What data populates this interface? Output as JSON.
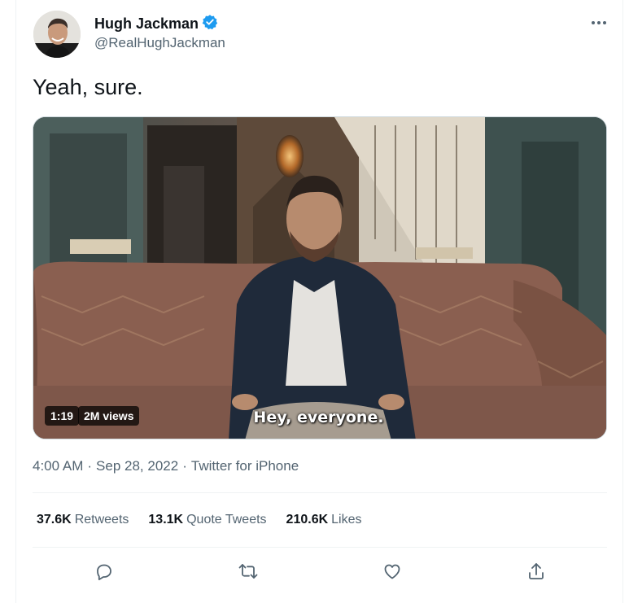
{
  "author": {
    "name": "Hugh Jackman",
    "handle": "@RealHughJackman",
    "verified_icon": "verified-badge-icon",
    "avatar_icon": "avatar"
  },
  "tweet": {
    "text": "Yeah, sure."
  },
  "media": {
    "duration": "1:19",
    "views": "2M views",
    "caption": "Hey, everyone."
  },
  "meta": {
    "time": "4:00 AM",
    "separator1": "·",
    "date": "Sep 28, 2022",
    "separator2": "·",
    "source": "Twitter for iPhone"
  },
  "stats": {
    "retweets_count": "37.6K",
    "retweets_label": "Retweets",
    "quotes_count": "13.1K",
    "quotes_label": "Quote Tweets",
    "likes_count": "210.6K",
    "likes_label": "Likes"
  },
  "icons": {
    "more": "more-icon",
    "reply": "reply-icon",
    "retweet": "retweet-icon",
    "like": "like-icon",
    "share": "share-icon"
  },
  "colors": {
    "accent": "#1d9bf0",
    "text_primary": "#0f1419",
    "text_secondary": "#536471",
    "border": "#eff3f4"
  }
}
